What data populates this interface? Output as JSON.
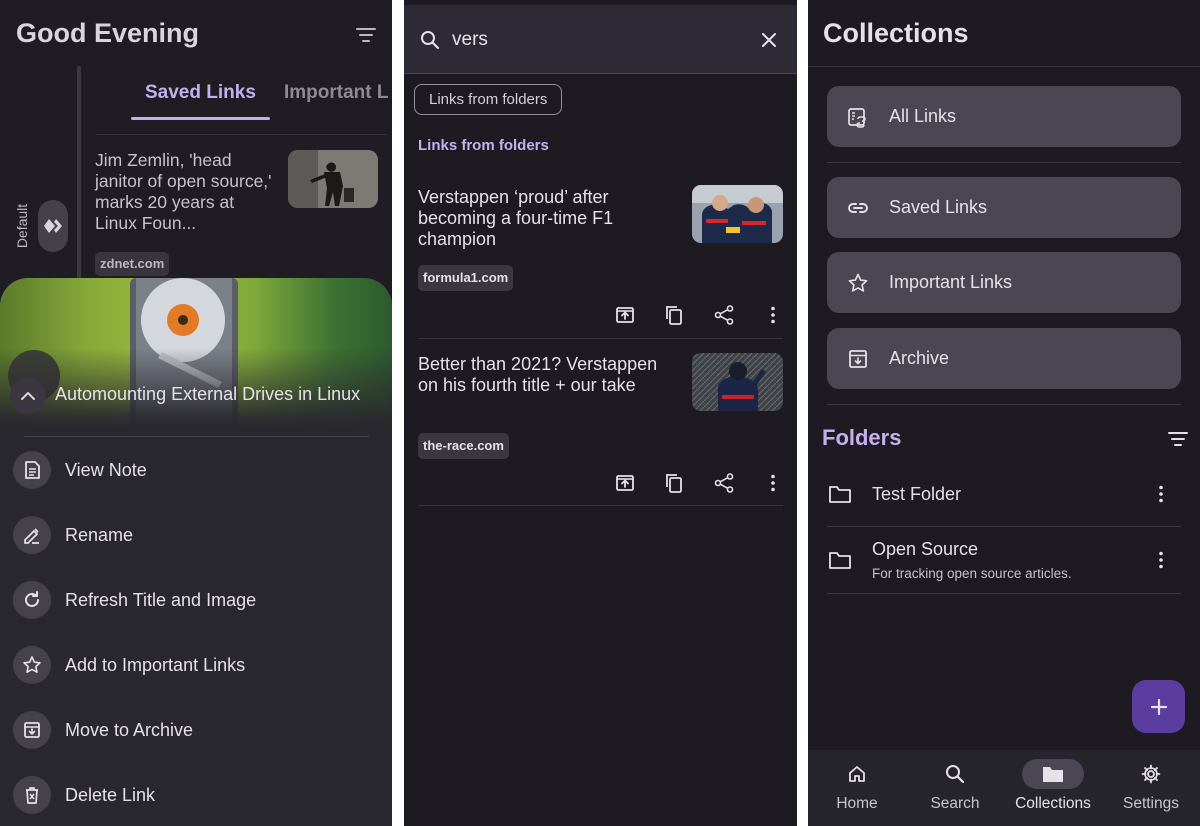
{
  "colors": {
    "accent": "#c5b0ef",
    "background": "#1d1b21",
    "surface": "#2a282f",
    "card": "#4a4752",
    "fab": "#5a3d9e"
  },
  "home": {
    "greeting": "Good Evening",
    "sort_icon": "sort-icon",
    "tabs": [
      {
        "label": "Saved Links",
        "active": true
      },
      {
        "label": "Important L",
        "active": false
      }
    ],
    "side_label": "Default",
    "card": {
      "title": "Jim Zemlin, 'head janitor of open source,' marks 20 years at Linux Foun...",
      "domain": "zdnet.com"
    },
    "sheet": {
      "title": "Automounting External Drives in Linux",
      "menu": [
        {
          "label": "View Note",
          "icon": "note-icon"
        },
        {
          "label": "Rename",
          "icon": "edit-icon"
        },
        {
          "label": "Refresh Title and Image",
          "icon": "refresh-icon"
        },
        {
          "label": "Add to Important Links",
          "icon": "star-icon"
        },
        {
          "label": "Move to Archive",
          "icon": "archive-icon"
        },
        {
          "label": "Delete Link",
          "icon": "delete-icon"
        }
      ]
    }
  },
  "search": {
    "query": "vers",
    "filter_chip": "Links from folders",
    "section_title": "Links from folders",
    "results": [
      {
        "title": "Verstappen ‘proud’ after becoming a four-time F1 champion",
        "domain": "formula1.com"
      },
      {
        "title": "Better than 2021? Verstappen on his fourth title + our take",
        "domain": "the-race.com"
      }
    ]
  },
  "collections": {
    "title": "Collections",
    "items": [
      {
        "label": "All Links",
        "icon": "all-links-icon"
      },
      {
        "label": "Saved Links",
        "icon": "link-icon"
      },
      {
        "label": "Important Links",
        "icon": "star-icon"
      },
      {
        "label": "Archive",
        "icon": "archive-icon"
      }
    ],
    "folders_title": "Folders",
    "folders": [
      {
        "name": "Test Folder",
        "description": ""
      },
      {
        "name": "Open Source",
        "description": "For tracking open source articles."
      }
    ],
    "fab_icon": "plus-icon"
  },
  "nav": {
    "items": [
      {
        "label": "Home",
        "icon": "home-icon",
        "active": false
      },
      {
        "label": "Search",
        "icon": "search-icon",
        "active": false
      },
      {
        "label": "Collections",
        "icon": "folder-icon",
        "active": true
      },
      {
        "label": "Settings",
        "icon": "gear-icon",
        "active": false
      }
    ]
  }
}
